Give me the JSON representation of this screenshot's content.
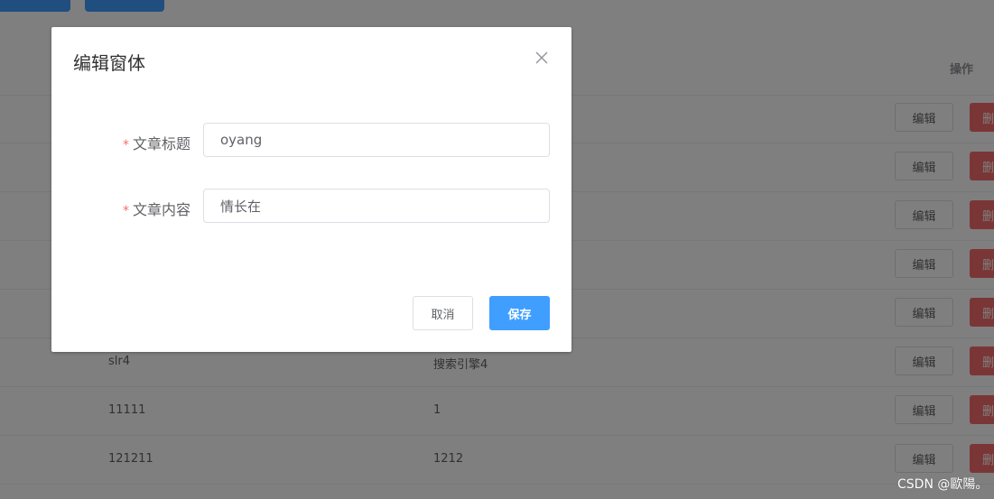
{
  "table": {
    "op_header": "操作",
    "edit_label": "编辑",
    "delete_label_partial": "删",
    "rows": [
      {
        "a": "",
        "b": ""
      },
      {
        "a": "",
        "b": ""
      },
      {
        "a": "",
        "b": ""
      },
      {
        "a": "",
        "b": ""
      },
      {
        "a": "",
        "b": ""
      },
      {
        "a": "slr4",
        "b": "搜索引擎4"
      },
      {
        "a": "11111",
        "b": "1"
      },
      {
        "a": "121211",
        "b": "1212"
      }
    ]
  },
  "dialog": {
    "title": "编辑窗体",
    "fields": [
      {
        "label": "文章标题",
        "value": "oyang"
      },
      {
        "label": "文章内容",
        "value": "情长在"
      }
    ],
    "required_mark": "*",
    "cancel_label": "取消",
    "save_label": "保存"
  },
  "watermark": "CSDN @歐陽。",
  "colors": {
    "primary": "#409eff",
    "danger": "#f56c6c",
    "overlay": "rgba(0,0,0,0.5)"
  }
}
